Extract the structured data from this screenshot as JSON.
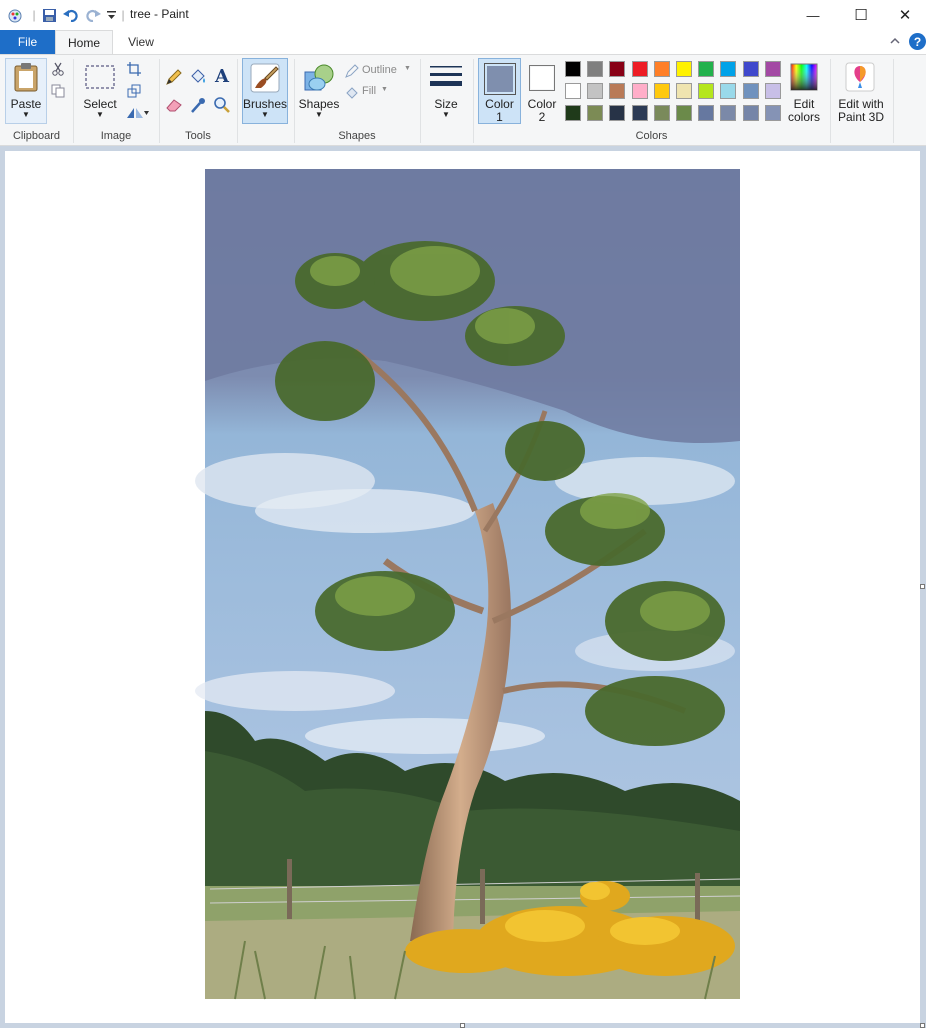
{
  "window": {
    "title": "tree - Paint",
    "minimize_glyph": "—",
    "maximize_glyph": "☐",
    "close_glyph": "✕"
  },
  "tabs": {
    "file": "File",
    "home": "Home",
    "view": "View"
  },
  "ribbon": {
    "clipboard": {
      "paste": "Paste",
      "group": "Clipboard"
    },
    "image": {
      "select": "Select",
      "group": "Image"
    },
    "tools": {
      "group": "Tools",
      "text_glyph": "A"
    },
    "brushes": {
      "label": "Brushes"
    },
    "shapes": {
      "label": "Shapes",
      "outline": "Outline",
      "fill": "Fill",
      "group": "Shapes"
    },
    "size": {
      "label": "Size"
    },
    "colors": {
      "color1_line1": "Color",
      "color1_line2": "1",
      "color2_line1": "Color",
      "color2_line2": "2",
      "edit_line1": "Edit",
      "edit_line2": "colors",
      "paint3d_line1": "Edit with",
      "paint3d_line2": "Paint 3D",
      "group": "Colors",
      "color1_value": "#7f8fae",
      "color2_value": "#ffffff",
      "palette": [
        "#000000",
        "#7f7f7f",
        "#880015",
        "#ed1c24",
        "#ff7f27",
        "#fff200",
        "#22b14c",
        "#00a2e8",
        "#3f48cc",
        "#a349a4",
        "#ffffff",
        "#c3c3c3",
        "#b97a57",
        "#ffaec9",
        "#ffc90e",
        "#efe4b0",
        "#b5e61d",
        "#99d9ea",
        "#7092be",
        "#c8bfe7",
        "#1f3a1a",
        "#7c8b55",
        "#273347",
        "#2b3a55",
        "#7a8a5b",
        "#6b8a4a",
        "#6678a0",
        "#7b89a8",
        "#7585a8",
        "#8593b5"
      ]
    }
  },
  "help_glyph": "?",
  "canvas": {
    "image_name": "tree painting"
  }
}
